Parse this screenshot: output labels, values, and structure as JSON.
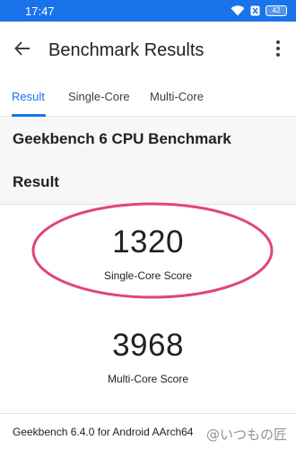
{
  "status_bar": {
    "time": "17:47",
    "battery_level": "42",
    "icons": [
      "wifi-icon",
      "nfc-icon",
      "battery-icon"
    ]
  },
  "toolbar": {
    "title": "Benchmark Results",
    "back_icon": "arrow-back-icon",
    "more_icon": "more-vert-icon"
  },
  "tabs": [
    {
      "label": "Result",
      "active": true
    },
    {
      "label": "Single-Core",
      "active": false
    },
    {
      "label": "Multi-Core",
      "active": false
    }
  ],
  "header": {
    "benchmark_title": "Geekbench 6 CPU Benchmark",
    "section_title": "Result"
  },
  "scores": {
    "single_core": {
      "value": "1320",
      "label": "Single-Core Score"
    },
    "multi_core": {
      "value": "3968",
      "label": "Multi-Core Score"
    }
  },
  "footer": {
    "version_text": "Geekbench 6.4.0 for Android AArch64"
  },
  "watermark": "@いつもの匠",
  "colors": {
    "accent": "#1a73e8",
    "annotation": "#e0457a"
  }
}
